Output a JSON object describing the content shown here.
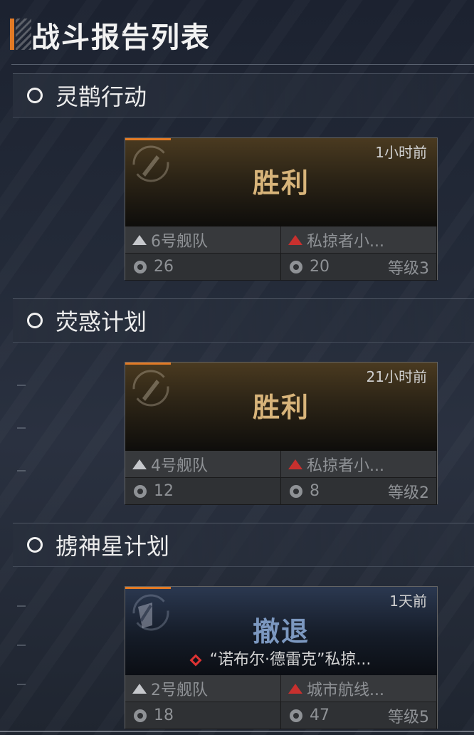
{
  "page_title": "战斗报告列表",
  "sections": [
    {
      "title": "灵鹊行动",
      "report": {
        "time": "1小时前",
        "result": "胜利",
        "result_type": "win",
        "opponent": "",
        "own_fleet": "6号舰队",
        "enemy": "私掠者小...",
        "own_power": "26",
        "enemy_power": "20",
        "level": "等级3"
      }
    },
    {
      "title": "荧惑计划",
      "report": {
        "time": "21小时前",
        "result": "胜利",
        "result_type": "win",
        "opponent": "",
        "own_fleet": "4号舰队",
        "enemy": "私掠者小...",
        "own_power": "12",
        "enemy_power": "8",
        "level": "等级2"
      }
    },
    {
      "title": "掳神星计划",
      "report": {
        "time": "1天前",
        "result": "撤退",
        "result_type": "retreat",
        "opponent": "“诺布尔·德雷克”私掠...",
        "own_fleet": "2号舰队",
        "enemy": "城市航线...",
        "own_power": "18",
        "enemy_power": "47",
        "level": "等级5"
      }
    }
  ],
  "colors": {
    "accent": "#e27a25",
    "win": "#d8b47a",
    "retreat": "#7c98c0",
    "enemy_marker": "#c8302e"
  }
}
